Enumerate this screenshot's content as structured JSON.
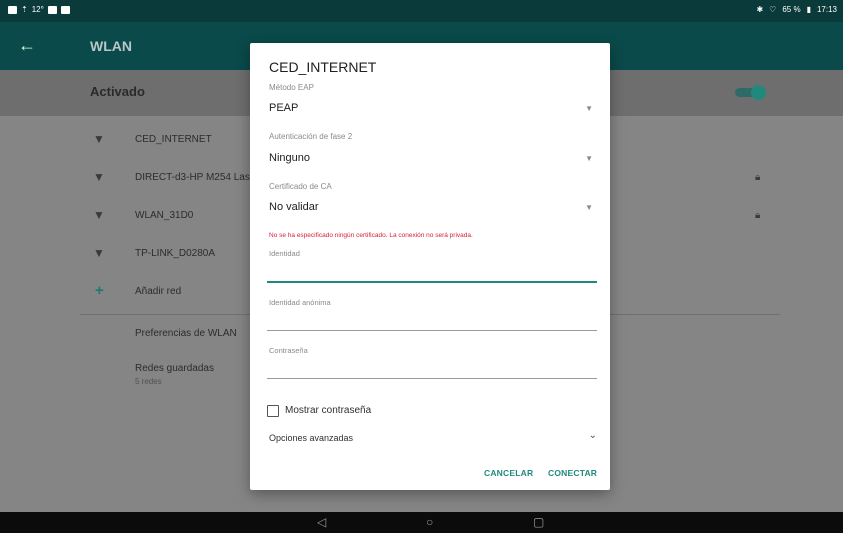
{
  "status_bar": {
    "temperature": "12°",
    "battery": "65 %",
    "time": "17:13"
  },
  "app_bar": {
    "title": "WLAN"
  },
  "wifi_master": {
    "label": "Activado",
    "enabled": true
  },
  "networks": [
    {
      "name": "CED_INTERNET",
      "locked": false
    },
    {
      "name": "DIRECT-d3-HP M254 Las",
      "locked": true
    },
    {
      "name": "WLAN_31D0",
      "locked": true
    },
    {
      "name": "TP-LINK_D0280A",
      "locked": true
    }
  ],
  "add_network": {
    "label": "Añadir red"
  },
  "preferences": {
    "wlan_prefs": "Preferencias de WLAN",
    "saved_networks": "Redes guardadas",
    "saved_networks_sub": "5 redes"
  },
  "dialog": {
    "title": "CED_INTERNET",
    "eap_method": {
      "label": "Método EAP",
      "value": "PEAP"
    },
    "phase2_auth": {
      "label": "Autenticación de fase 2",
      "value": "Ninguno"
    },
    "ca_certificate": {
      "label": "Certificado de CA",
      "value": "No validar"
    },
    "warning": "No se ha especificado ningún certificado. La conexión no será privada.",
    "identity": {
      "label": "Identidad",
      "value": ""
    },
    "anonymous_identity": {
      "label": "Identidad anónima",
      "value": ""
    },
    "password": {
      "label": "Contraseña",
      "value": ""
    },
    "show_password": {
      "label": "Mostrar contraseña",
      "checked": false
    },
    "advanced_options": "Opciones avanzadas",
    "cancel_button": "CANCELAR",
    "connect_button": "CONECTAR"
  },
  "colors": {
    "accent": "#1f8a7c",
    "error": "#d4223a"
  }
}
